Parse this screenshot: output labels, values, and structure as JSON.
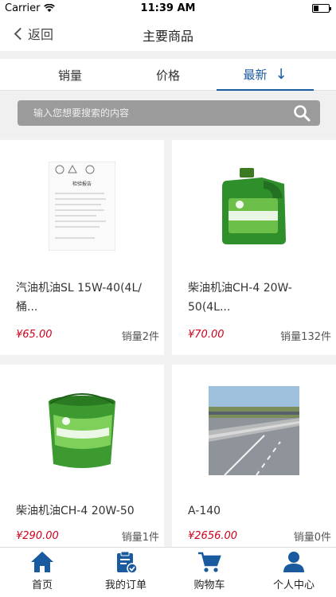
{
  "status": {
    "carrier": "Carrier",
    "time": "11:39 AM"
  },
  "nav": {
    "back_label": "返回",
    "title": "主要商品"
  },
  "tabs": {
    "sales": "销量",
    "price": "价格",
    "newest": "最新",
    "newest_arrow": "↓"
  },
  "search": {
    "placeholder": "输入您想要搜索的内容"
  },
  "products": [
    {
      "name": "汽油机油SL 15W-40(4L/桶...",
      "price": "¥65.00",
      "sales": "销量2件"
    },
    {
      "name": "柴油机油CH-4 20W-50(4L...",
      "price": "¥70.00",
      "sales": "销量132件"
    },
    {
      "name": "柴油机油CH-4 20W-50",
      "price": "¥290.00",
      "sales": "销量1件"
    },
    {
      "name": "A-140",
      "price": "¥2656.00",
      "sales": "销量0件"
    }
  ],
  "report_doc": {
    "title": "检验报告"
  },
  "tabbar": {
    "home": "首页",
    "orders": "我的订单",
    "cart": "购物车",
    "profile": "个人中心"
  },
  "colors": {
    "accent": "#1a5a9e",
    "price": "#d0021b",
    "search_bg": "#9b9b9b"
  }
}
